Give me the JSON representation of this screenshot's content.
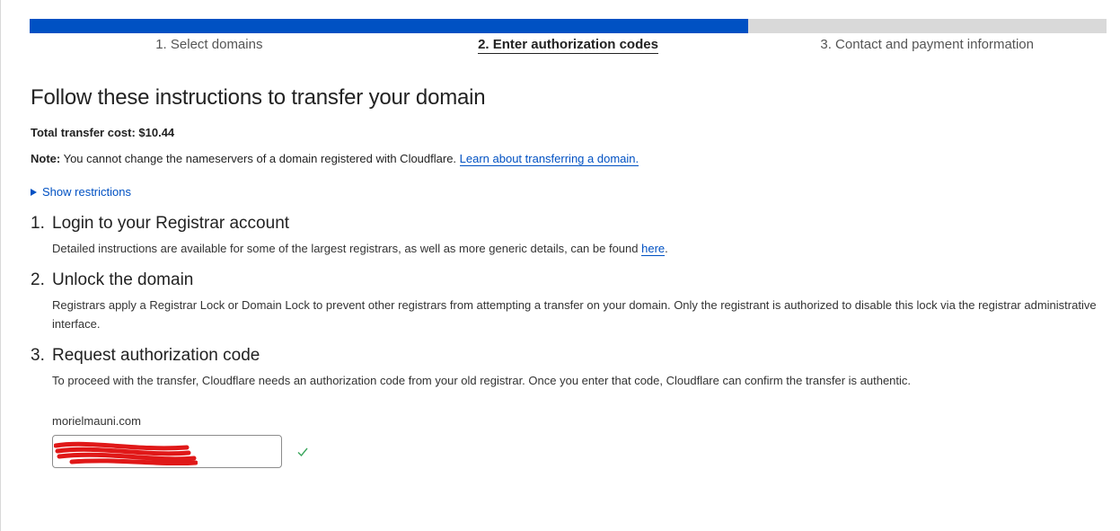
{
  "stepper": {
    "progress_fraction": 0.667,
    "colors": {
      "fill": "#0051c3",
      "track": "#d9d9d9"
    },
    "steps": [
      {
        "label": "1. Select domains",
        "active": false
      },
      {
        "label": "2. Enter authorization codes",
        "active": true
      },
      {
        "label": "3. Contact and payment information",
        "active": false
      }
    ]
  },
  "page": {
    "title": "Follow these instructions to transfer your domain",
    "total_cost": "Total transfer cost: $10.44",
    "note_label": "Note:",
    "note_text": " You cannot change the nameservers of a domain registered with Cloudflare. ",
    "note_link": "Learn about transferring a domain.",
    "restrictions_toggle": "Show restrictions"
  },
  "sections": [
    {
      "number": "1.",
      "title": "Login to your Registrar account",
      "body": "Detailed instructions are available for some of the largest registrars, as well as more generic details, can be found ",
      "link": "here",
      "body_after": "."
    },
    {
      "number": "2.",
      "title": "Unlock the domain",
      "body": "Registrars apply a Registrar Lock or Domain Lock to prevent other registrars from attempting a transfer on your domain. Only the registrant is authorized to disable this lock via the registrar administrative interface."
    },
    {
      "number": "3.",
      "title": "Request authorization code",
      "body": "To proceed with the transfer, Cloudflare needs an authorization code from your old registrar. Once you enter that code, Cloudflare can confirm the transfer is authentic."
    }
  ],
  "auth": {
    "domain": "morielmauni.com",
    "input_value": "",
    "redaction_color": "#e01818",
    "valid_icon": "check-icon",
    "valid_color": "#3aa55c"
  }
}
